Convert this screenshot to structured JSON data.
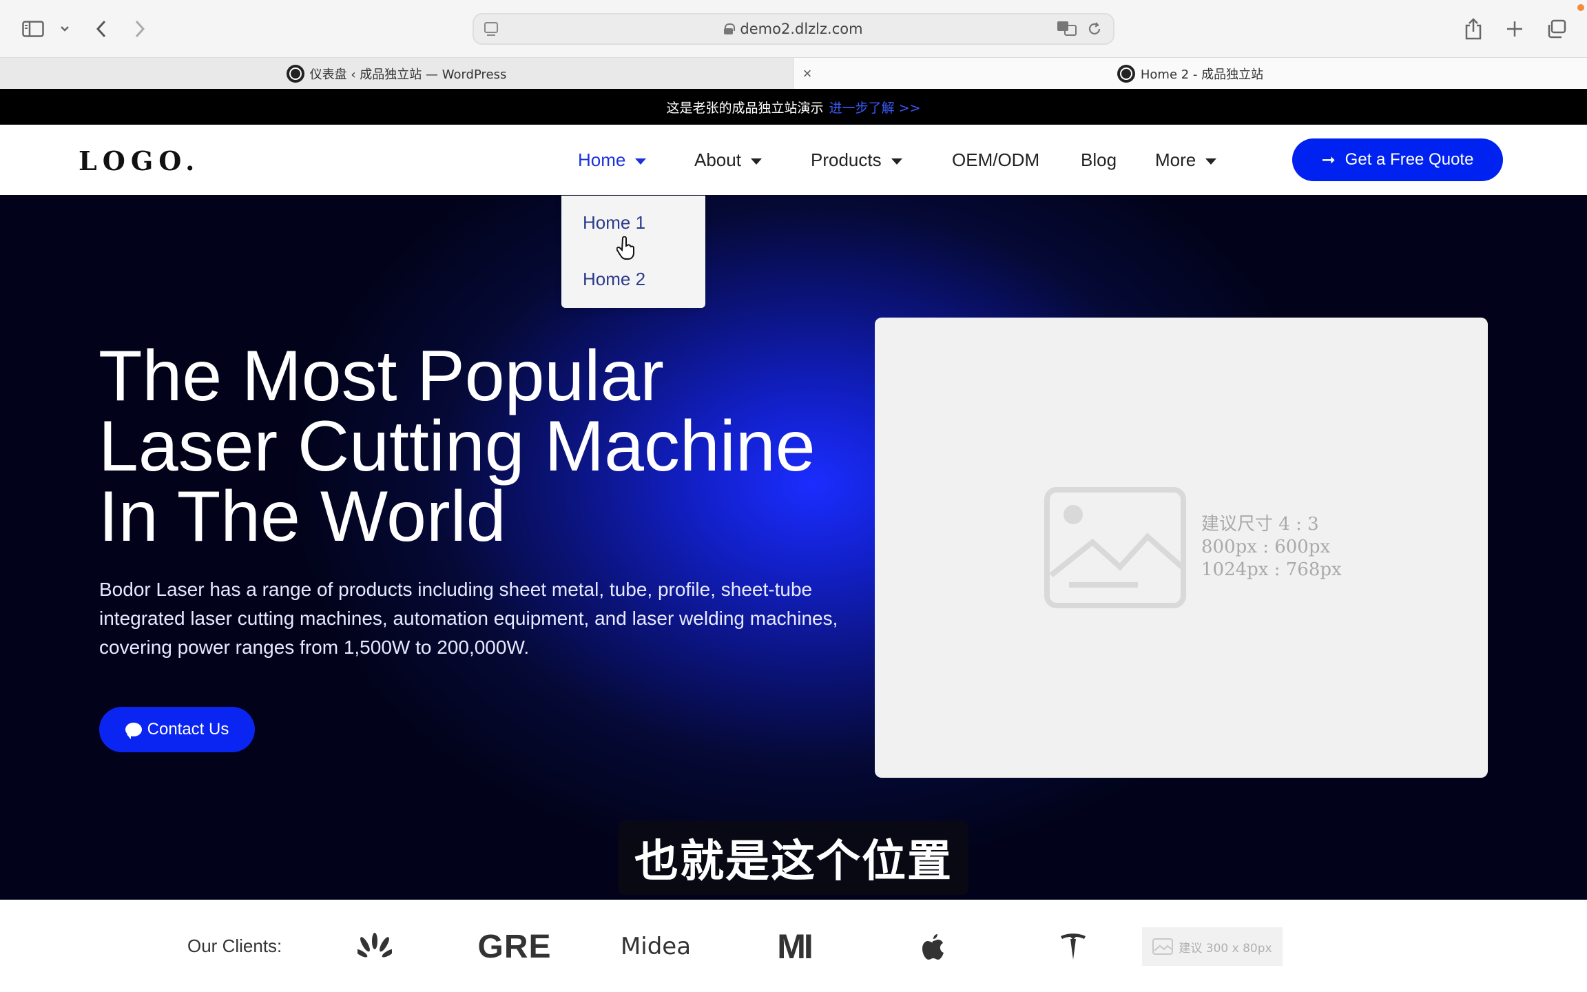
{
  "browser": {
    "url": "demo2.dlzlz.com",
    "tabs": [
      {
        "title": "仪表盘 ‹ 成品独立站 — WordPress",
        "active": false
      },
      {
        "title": "Home 2 - 成品独立站",
        "active": true
      }
    ]
  },
  "announcement": {
    "text": "这是老张的成品独立站演示",
    "link": "进一步了解 >>"
  },
  "header": {
    "logo": "LOGO.",
    "nav": [
      {
        "label": "Home",
        "has_dropdown": true
      },
      {
        "label": "About",
        "has_dropdown": true
      },
      {
        "label": "Products",
        "has_dropdown": true
      },
      {
        "label": "OEM/ODM",
        "has_dropdown": false
      },
      {
        "label": "Blog",
        "has_dropdown": false
      },
      {
        "label": "More",
        "has_dropdown": true
      }
    ],
    "cta": "Get a Free Quote"
  },
  "dropdown": {
    "items": [
      "Home 1",
      "Home 2"
    ]
  },
  "hero": {
    "title_lines": [
      "The Most Popular",
      "Laser Cutting Machine",
      "In The World"
    ],
    "description": "Bodor Laser has a range of products including sheet metal, tube, profile, sheet-tube integrated laser cutting machines, automation equipment, and laser welding machines, covering power ranges from 1,500W to 200,000W.",
    "button": "Contact Us",
    "image_placeholder": {
      "lines": [
        "建议尺寸 4 : 3",
        "800px : 600px",
        "1024px : 768px"
      ]
    }
  },
  "video_subtitle": "也就是这个位置",
  "clients": {
    "label": "Our Clients:",
    "logos": [
      "huawei-logo",
      "GRE",
      "Midea",
      "MI",
      "apple-logo",
      "tesla-logo"
    ],
    "placeholder": "建议 300 x 80px"
  },
  "colors": {
    "accent": "#0022f0",
    "nav_active": "#1b33d6",
    "announce_link": "#3a5cff"
  }
}
